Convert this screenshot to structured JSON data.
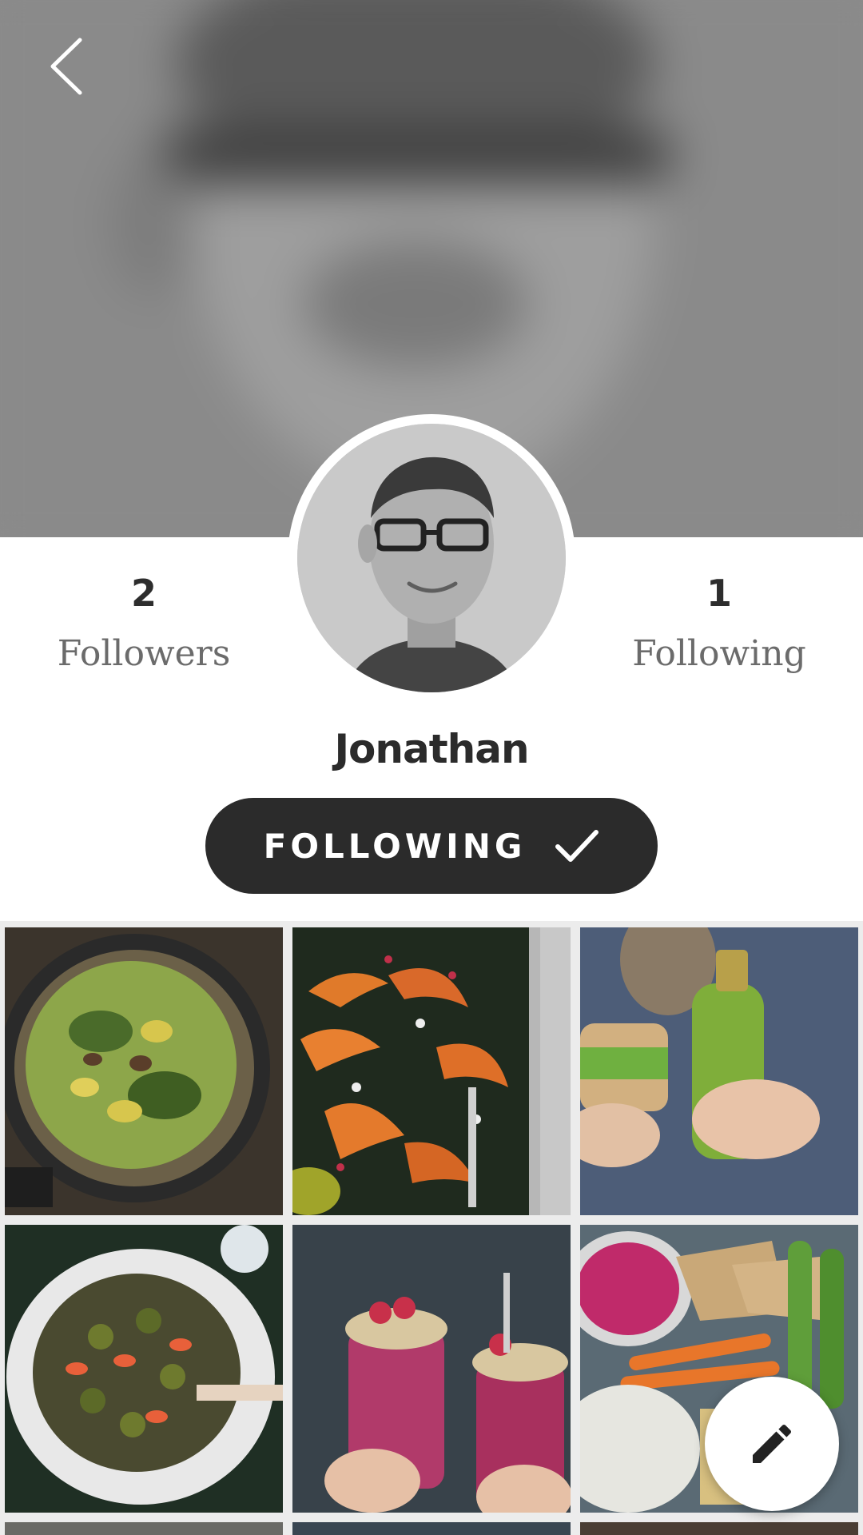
{
  "header": {
    "back_icon": "chevron-left-icon"
  },
  "profile": {
    "name": "Jonathan",
    "followers_count": "2",
    "followers_label": "Followers",
    "following_count": "1",
    "following_label": "Following"
  },
  "follow_button": {
    "label": "FOLLOWING",
    "icon": "checkmark-icon"
  },
  "grid": {
    "items": [
      {
        "subject": "spinach frittata in skillet"
      },
      {
        "subject": "roasted squash kale salad"
      },
      {
        "subject": "sandwich and green smoothie bottle"
      },
      {
        "subject": "brussels sprouts grapefruit salad"
      },
      {
        "subject": "raspberry granola jars"
      },
      {
        "subject": "beet hummus vegetable platter"
      }
    ]
  },
  "fab": {
    "icon": "pencil-icon"
  },
  "colors": {
    "button_dark": "#2b2b2b",
    "grid_background": "#ececec",
    "text_muted": "#6b6b6b"
  }
}
